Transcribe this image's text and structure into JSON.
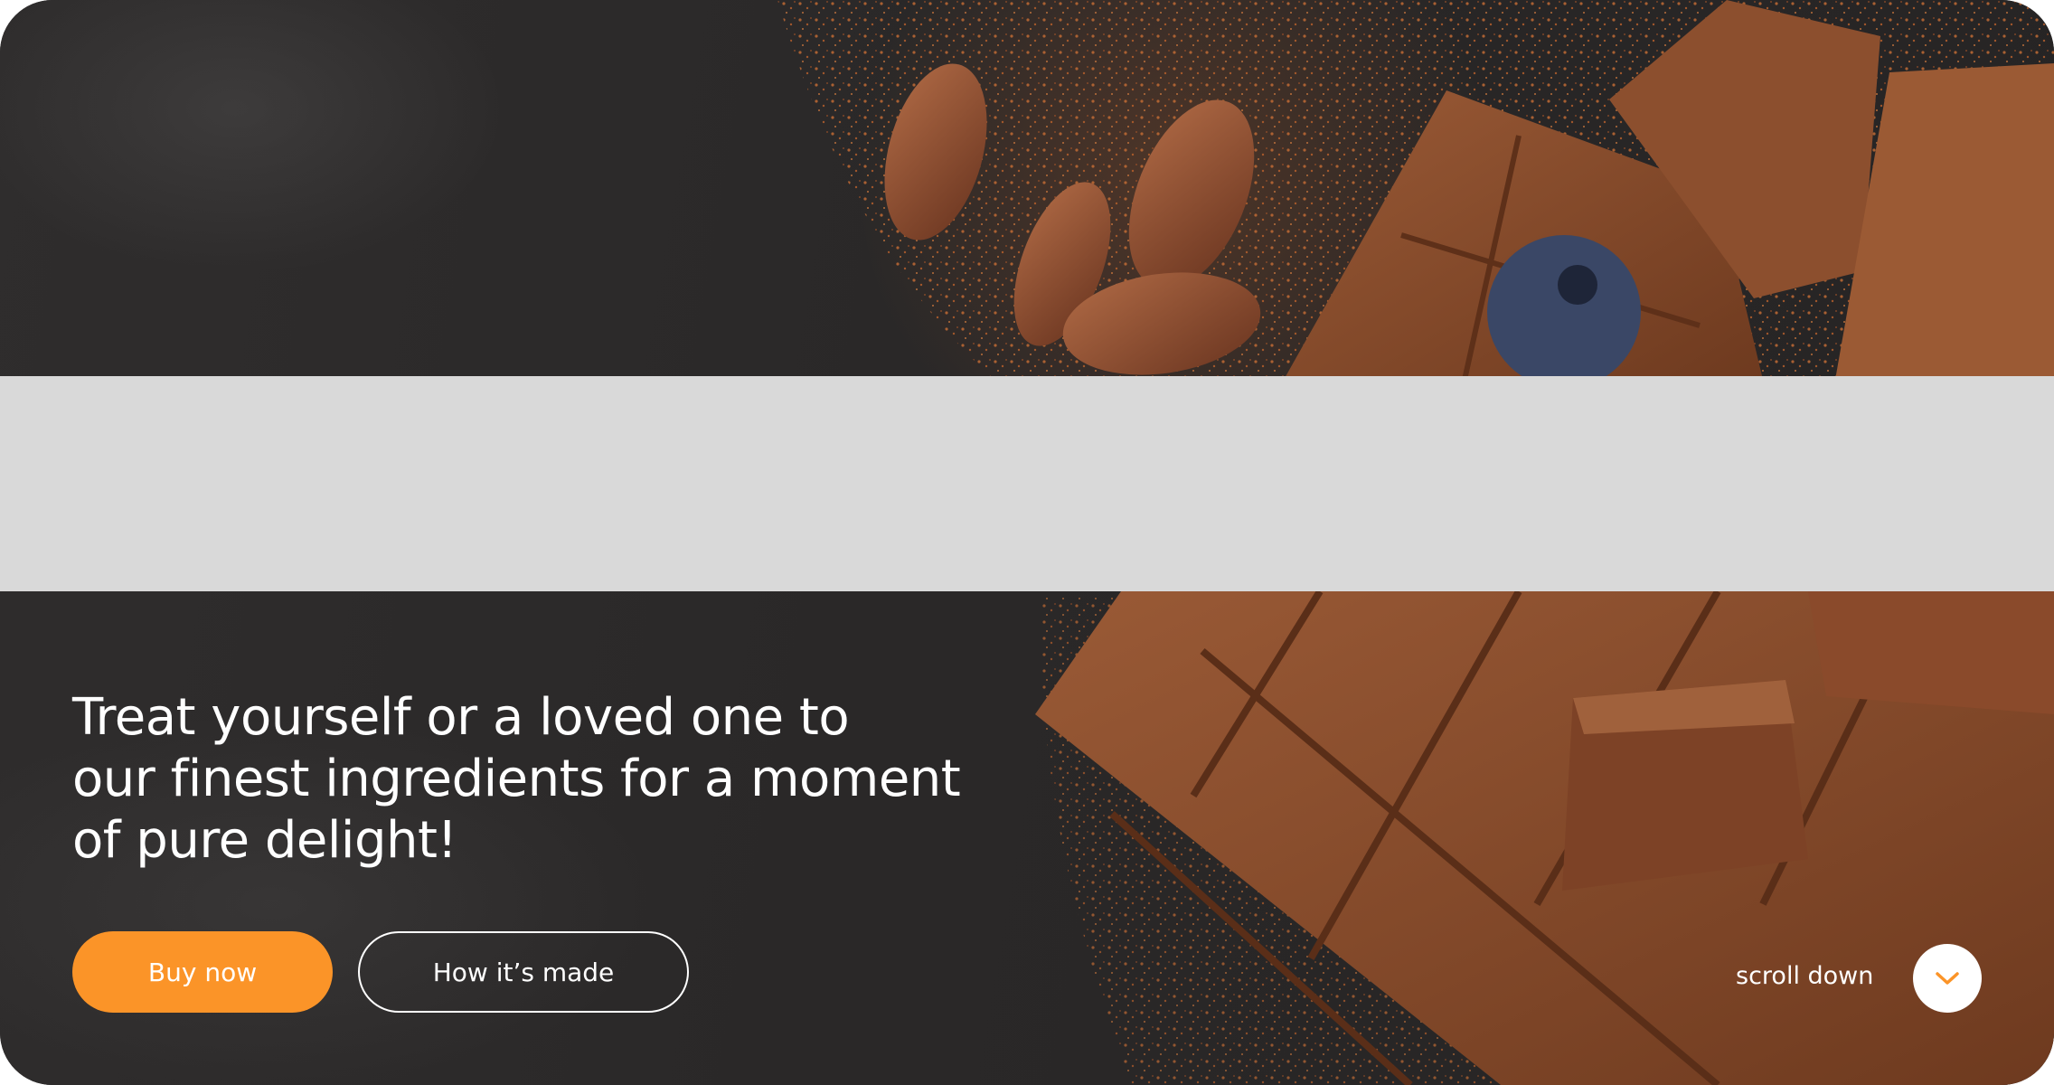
{
  "hero": {
    "headline_line1": "Treat yourself or a loved one to",
    "headline_line2": "our finest ingredients for a moment",
    "headline_line3": "of pure delight!",
    "background_image": "chocolate-bars-and-cocoa-beans-photo"
  },
  "actions": {
    "buy_now_label": "Buy now",
    "how_made_label": "How it’s made"
  },
  "scroll": {
    "label": "scroll down",
    "icon": "chevron-down-icon"
  },
  "colors": {
    "accent": "#fb9428",
    "background": "#2a2828",
    "band": "#d9d9d9",
    "text": "#ffffff"
  }
}
